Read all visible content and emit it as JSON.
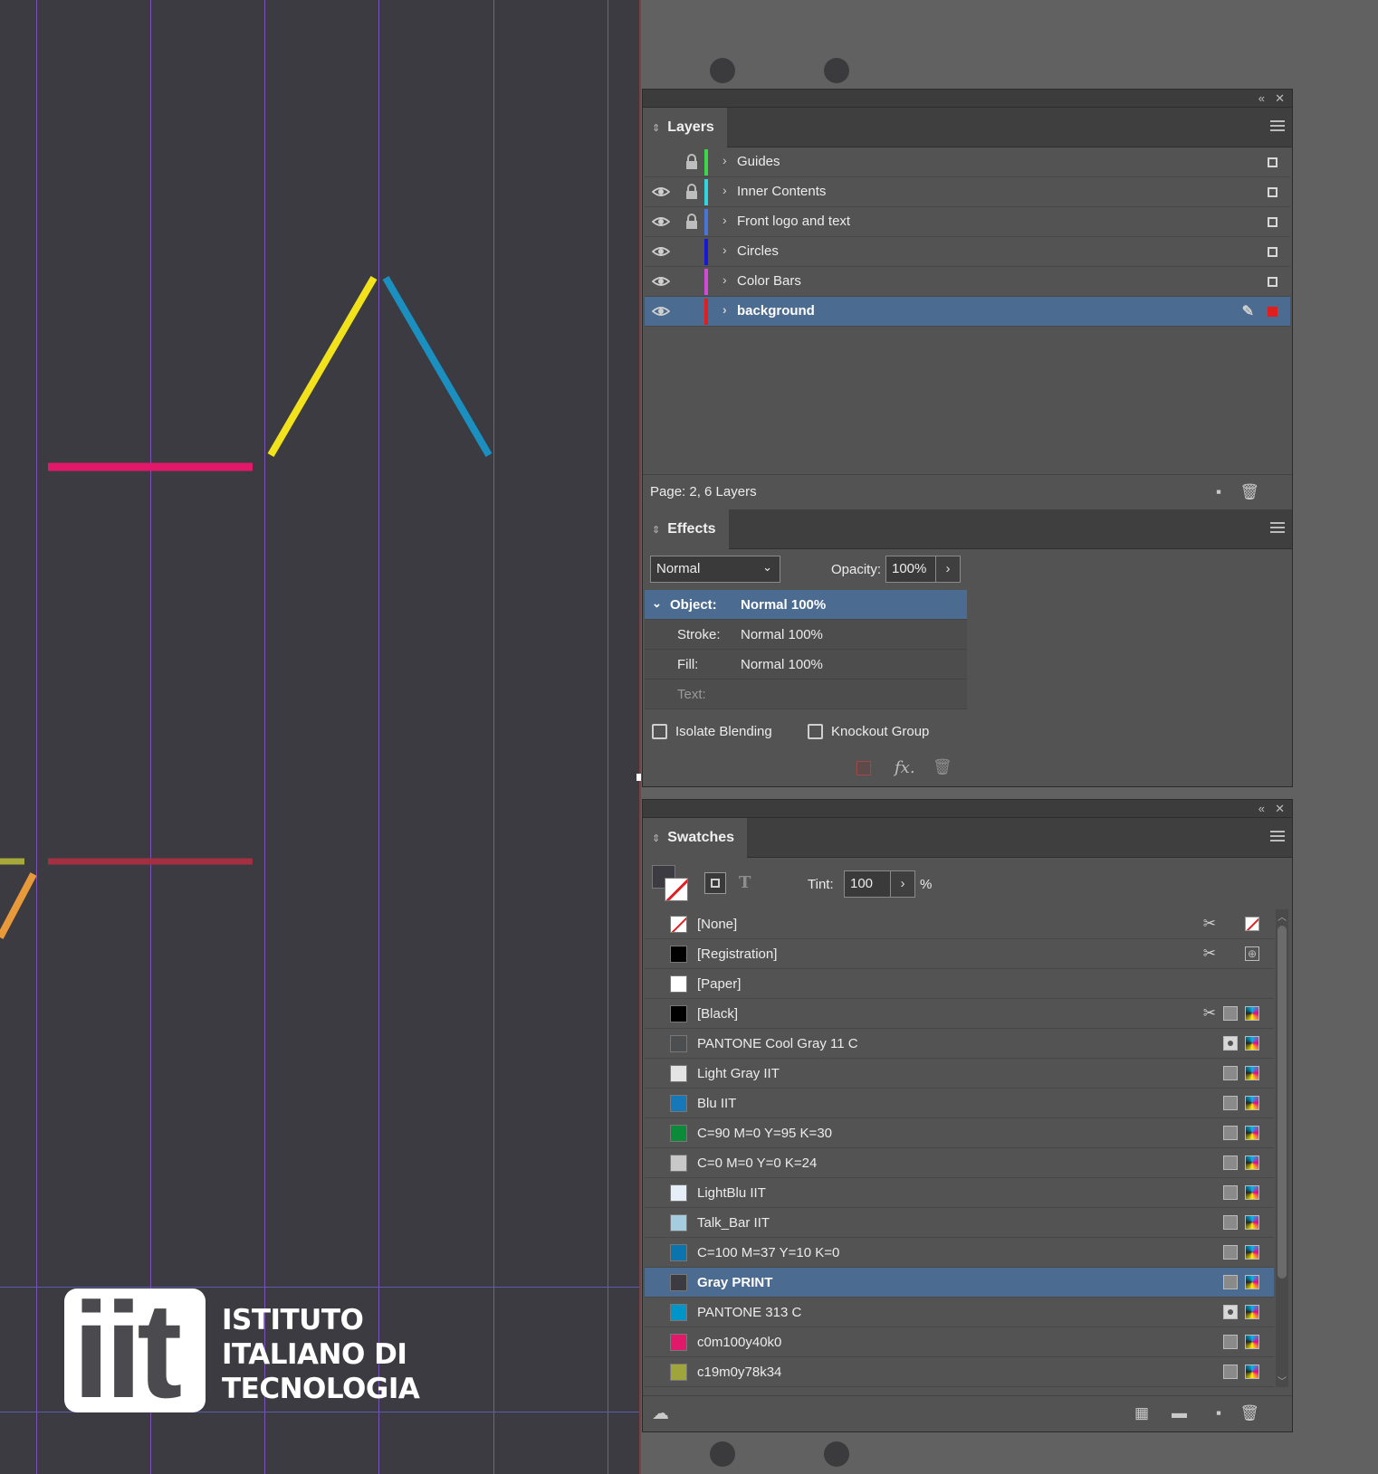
{
  "layers_panel": {
    "tab_label": "Layers",
    "rows": [
      {
        "name": "Guides",
        "color": "#3ed64a",
        "visible": false,
        "locked": true,
        "selected": false
      },
      {
        "name": "Inner Contents",
        "color": "#2fd6e0",
        "visible": true,
        "locked": true,
        "selected": false
      },
      {
        "name": "Front logo and text",
        "color": "#4a74d9",
        "visible": true,
        "locked": true,
        "selected": false
      },
      {
        "name": "Circles",
        "color": "#1818d8",
        "visible": true,
        "locked": false,
        "selected": false
      },
      {
        "name": "Color Bars",
        "color": "#d34ad7",
        "visible": true,
        "locked": false,
        "selected": false
      },
      {
        "name": "background",
        "color": "#e21d1d",
        "visible": true,
        "locked": false,
        "selected": true
      }
    ],
    "footer_text": "Page: 2, 6 Layers"
  },
  "effects_panel": {
    "tab_label": "Effects",
    "blend_mode": "Normal",
    "opacity_label": "Opacity:",
    "opacity_value": "100%",
    "rows": [
      {
        "key": "Object:",
        "value": "Normal 100%"
      },
      {
        "key": "Stroke:",
        "value": "Normal 100%"
      },
      {
        "key": "Fill:",
        "value": "Normal 100%"
      },
      {
        "key": "Text:",
        "value": ""
      }
    ],
    "isolate_label": "Isolate Blending",
    "knockout_label": "Knockout Group",
    "fx_label": "fx."
  },
  "swatches_panel": {
    "tab_label": "Swatches",
    "tint_label": "Tint:",
    "tint_value": "100",
    "percent": "%",
    "rows": [
      {
        "name": "[None]",
        "color": "none"
      },
      {
        "name": "[Registration]",
        "color": "#000000"
      },
      {
        "name": "[Paper]",
        "color": "#ffffff"
      },
      {
        "name": "[Black]",
        "color": "#000000"
      },
      {
        "name": "PANTONE Cool Gray 11 C",
        "color": "#4d4e50"
      },
      {
        "name": "Light Gray IIT",
        "color": "#e4e4e4"
      },
      {
        "name": "Blu IIT",
        "color": "#1678b8"
      },
      {
        "name": "C=90 M=0 Y=95 K=30",
        "color": "#0b8a3a"
      },
      {
        "name": "C=0 M=0 Y=0 K=24",
        "color": "#c8c8c8"
      },
      {
        "name": "LightBlu IIT",
        "color": "#e6eef8"
      },
      {
        "name": "Talk_Bar IIT",
        "color": "#a6cce0"
      },
      {
        "name": "C=100 M=37 Y=10 K=0",
        "color": "#0b74ad"
      },
      {
        "name": "Gray PRINT",
        "color": "#3b3b41"
      },
      {
        "name": "PANTONE 313 C",
        "color": "#0094c8"
      },
      {
        "name": "c0m100y40k0",
        "color": "#e2196a"
      },
      {
        "name": "c19m0y78k34",
        "color": "#9fa43b"
      }
    ]
  },
  "canvas": {
    "logo_glyphs": "iit",
    "logo_lines": [
      "ISTITUTO",
      "ITALIANO DI",
      "TECNOLOGIA"
    ]
  },
  "colors": {
    "selection": "#4b6b91",
    "magenta_bar": "#e2196a",
    "yellow_line": "#f2e21c",
    "blue_line": "#1a8fc0",
    "dark_red_bar": "#a23040",
    "orange_line": "#e89a3b"
  }
}
